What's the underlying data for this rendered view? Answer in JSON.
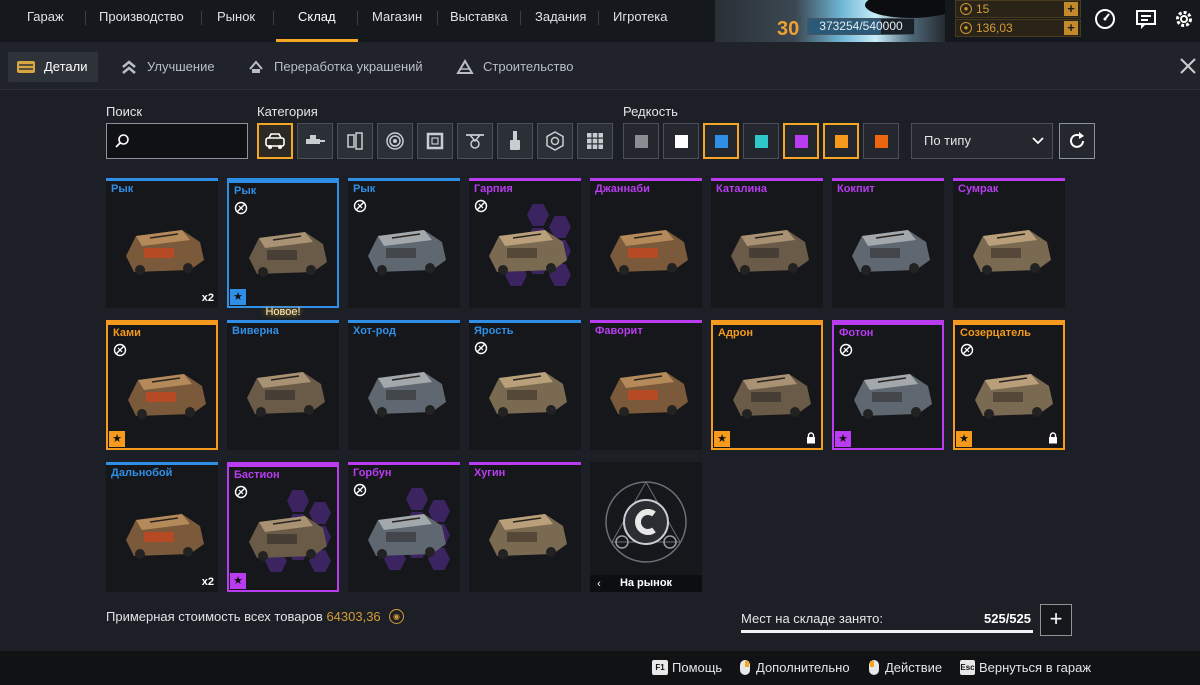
{
  "nav": {
    "items": [
      "Гараж",
      "Производство",
      "Рынок",
      "Склад",
      "Магазин",
      "Выставка",
      "Задания",
      "Игротека"
    ],
    "active": "Склад"
  },
  "player": {
    "level": "30",
    "xp": "373254/540000",
    "xp_progress": 0.69
  },
  "currencies": [
    {
      "value": "15"
    },
    {
      "value": "136,03"
    }
  ],
  "tabs": {
    "items": [
      "Детали",
      "Улучшение",
      "Переработка украшений",
      "Строительство"
    ],
    "active": "Детали"
  },
  "filters": {
    "search_label": "Поиск",
    "search_value": "",
    "category_label": "Категория",
    "categories": [
      "cabin-icon",
      "weapon-icon",
      "hardware-icon",
      "wheel-icon",
      "frame-icon",
      "drone-icon",
      "paint-icon",
      "module-icon",
      "grid-icon"
    ],
    "category_active": "cabin-icon",
    "rarity_label": "Редкость",
    "rarities": [
      {
        "color": "#8a8d91",
        "active": false
      },
      {
        "color": "#ffffff",
        "active": false
      },
      {
        "color": "#2f8fe6",
        "active": true
      },
      {
        "color": "#2ec8c8",
        "active": false
      },
      {
        "color": "#b93cf0",
        "active": true
      },
      {
        "color": "#f59a1c",
        "active": true
      },
      {
        "color": "#ee6510",
        "active": false
      }
    ],
    "sort_value": "По типу"
  },
  "rarity_colors": {
    "rare": "#2f8fe6",
    "epic": "#b93cf0",
    "legendary": "#f59a1c"
  },
  "items": [
    {
      "name": "Рык",
      "rarity": "rare",
      "qty": "x2"
    },
    {
      "name": "Рык",
      "rarity": "rare",
      "no_sell": true,
      "star": true,
      "selected": true,
      "new_label": "Новое!"
    },
    {
      "name": "Рык",
      "rarity": "rare",
      "no_sell": true
    },
    {
      "name": "Гарпия",
      "rarity": "epic",
      "no_sell": true,
      "hex": true
    },
    {
      "name": "Джаннаби",
      "rarity": "epic"
    },
    {
      "name": "Каталина",
      "rarity": "epic"
    },
    {
      "name": "Кокпит",
      "rarity": "epic"
    },
    {
      "name": "Сумрак",
      "rarity": "epic"
    },
    {
      "name": "Ками",
      "rarity": "legendary",
      "no_sell": true,
      "star": true,
      "selected": true
    },
    {
      "name": "Виверна",
      "rarity": "rare"
    },
    {
      "name": "Хот-род",
      "rarity": "rare"
    },
    {
      "name": "Ярость",
      "rarity": "rare",
      "no_sell": true
    },
    {
      "name": "Фаворит",
      "rarity": "epic"
    },
    {
      "name": "Адрон",
      "rarity": "legendary",
      "star": true,
      "lock": true,
      "selected": true
    },
    {
      "name": "Фотон",
      "rarity": "epic",
      "no_sell": true,
      "star": true,
      "selected": true
    },
    {
      "name": "Созерцатель",
      "rarity": "legendary",
      "no_sell": true,
      "star": true,
      "lock": true,
      "selected": true
    },
    {
      "name": "Дальнобой",
      "rarity": "rare",
      "qty": "x2"
    },
    {
      "name": "Бастион",
      "rarity": "epic",
      "no_sell": true,
      "star": true,
      "selected": true,
      "hex": true
    },
    {
      "name": "Горбун",
      "rarity": "epic",
      "no_sell": true,
      "hex": true
    },
    {
      "name": "Хугин",
      "rarity": "epic"
    }
  ],
  "market_tile": {
    "label": "На рынок"
  },
  "summary": {
    "label": "Примерная стоимость всех товаров",
    "value": "64303,36"
  },
  "storage": {
    "label": "Мест на складе занято:",
    "value": "525/525",
    "fill": 1.0
  },
  "footer_hints": [
    {
      "key": "F1",
      "label": "Помощь"
    },
    {
      "key": "mouse-icon",
      "label": "Дополнительно"
    },
    {
      "key": "mouse-icon",
      "label": "Действие"
    },
    {
      "key": "Esc",
      "label": "Вернуться в гараж"
    }
  ]
}
